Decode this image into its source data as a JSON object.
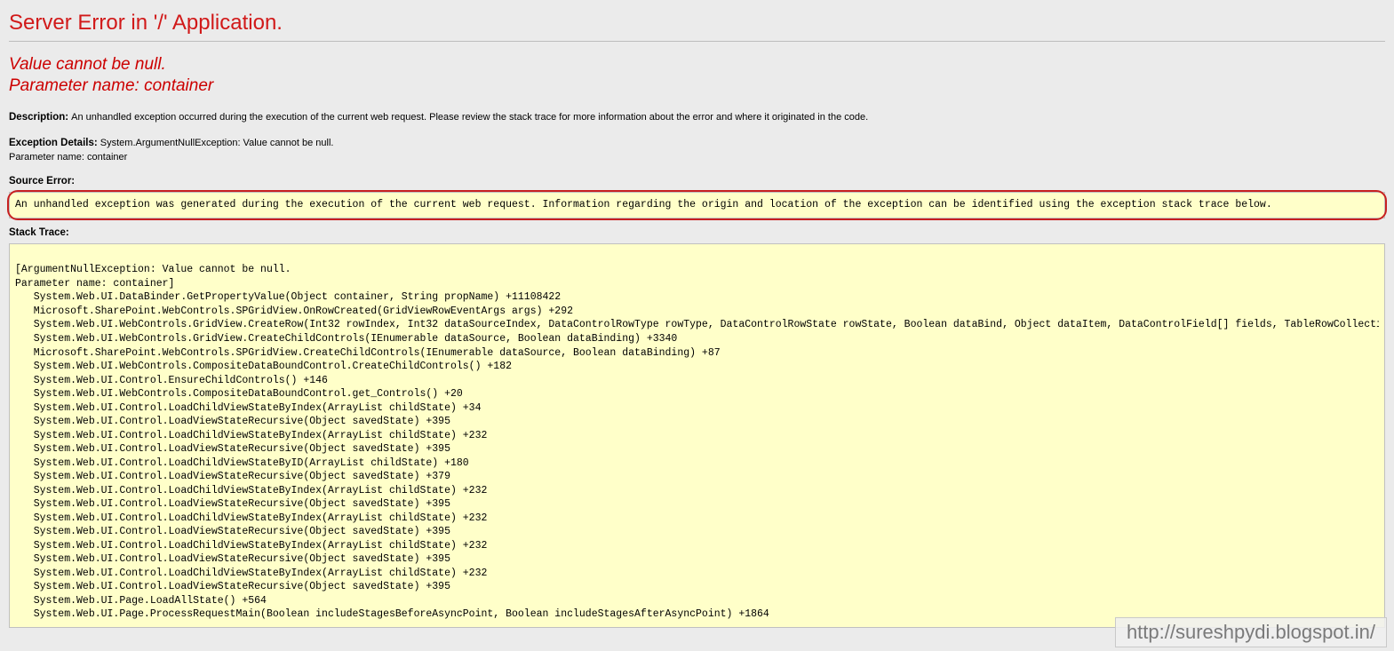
{
  "title": "Server Error in '/' Application.",
  "subtitle": "Value cannot be null.\nParameter name: container",
  "description": {
    "label": "Description:",
    "text": "An unhandled exception occurred during the execution of the current web request. Please review the stack trace for more information about the error and where it originated in the code."
  },
  "exception_details": {
    "label": "Exception Details:",
    "text": "System.ArgumentNullException: Value cannot be null.\nParameter name: container"
  },
  "source_error": {
    "label": "Source Error:",
    "text": "An unhandled exception was generated during the execution of the current web request. Information regarding the origin and location of the exception can be identified using the exception stack trace below."
  },
  "stack_trace": {
    "label": "Stack Trace:",
    "text": "\n[ArgumentNullException: Value cannot be null.\nParameter name: container]\n   System.Web.UI.DataBinder.GetPropertyValue(Object container, String propName) +11108422\n   Microsoft.SharePoint.WebControls.SPGridView.OnRowCreated(GridViewRowEventArgs args) +292\n   System.Web.UI.WebControls.GridView.CreateRow(Int32 rowIndex, Int32 dataSourceIndex, DataControlRowType rowType, DataControlRowState rowState, Boolean dataBind, Object dataItem, DataControlField[] fields, TableRowCollecti\n   System.Web.UI.WebControls.GridView.CreateChildControls(IEnumerable dataSource, Boolean dataBinding) +3340\n   Microsoft.SharePoint.WebControls.SPGridView.CreateChildControls(IEnumerable dataSource, Boolean dataBinding) +87\n   System.Web.UI.WebControls.CompositeDataBoundControl.CreateChildControls() +182\n   System.Web.UI.Control.EnsureChildControls() +146\n   System.Web.UI.WebControls.CompositeDataBoundControl.get_Controls() +20\n   System.Web.UI.Control.LoadChildViewStateByIndex(ArrayList childState) +34\n   System.Web.UI.Control.LoadViewStateRecursive(Object savedState) +395\n   System.Web.UI.Control.LoadChildViewStateByIndex(ArrayList childState) +232\n   System.Web.UI.Control.LoadViewStateRecursive(Object savedState) +395\n   System.Web.UI.Control.LoadChildViewStateByID(ArrayList childState) +180\n   System.Web.UI.Control.LoadViewStateRecursive(Object savedState) +379\n   System.Web.UI.Control.LoadChildViewStateByIndex(ArrayList childState) +232\n   System.Web.UI.Control.LoadViewStateRecursive(Object savedState) +395\n   System.Web.UI.Control.LoadChildViewStateByIndex(ArrayList childState) +232\n   System.Web.UI.Control.LoadViewStateRecursive(Object savedState) +395\n   System.Web.UI.Control.LoadChildViewStateByIndex(ArrayList childState) +232\n   System.Web.UI.Control.LoadViewStateRecursive(Object savedState) +395\n   System.Web.UI.Control.LoadChildViewStateByIndex(ArrayList childState) +232\n   System.Web.UI.Control.LoadViewStateRecursive(Object savedState) +395\n   System.Web.UI.Page.LoadAllState() +564\n   System.Web.UI.Page.ProcessRequestMain(Boolean includeStagesBeforeAsyncPoint, Boolean includeStagesAfterAsyncPoint) +1864"
  },
  "watermark": "http://sureshpydi.blogspot.in/"
}
